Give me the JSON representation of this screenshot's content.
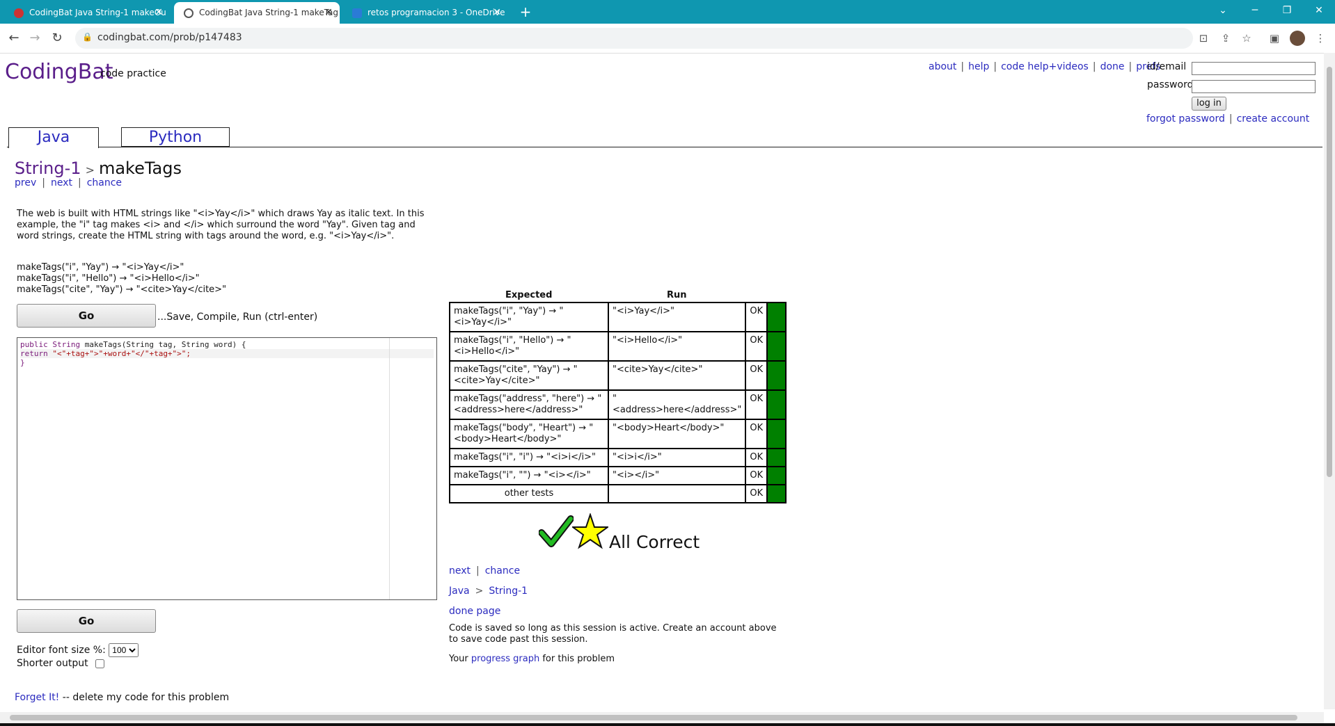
{
  "browser": {
    "tabs": [
      {
        "title": "CodingBat Java String-1 makeOu",
        "active": false
      },
      {
        "title": "CodingBat Java String-1 makeTag",
        "active": true
      },
      {
        "title": "retos programacion 3 - OneDrive",
        "active": false
      }
    ],
    "url": "codingbat.com/prob/p147483"
  },
  "site": {
    "logo": "CodingBat",
    "logo_sub": "code practice",
    "toplinks": [
      "about",
      "help",
      "code help+videos",
      "done",
      "prefs"
    ],
    "login": {
      "id_label": "id/email",
      "password_label": "password",
      "login_button": "log in",
      "forgot": "forgot password",
      "create": "create account"
    },
    "lang_tabs": [
      "Java",
      "Python"
    ]
  },
  "problem": {
    "section": "String-1",
    "name": "makeTags",
    "nav": [
      "prev",
      "next",
      "chance"
    ],
    "description": "The web is built with HTML strings like \"<i>Yay</i>\" which draws Yay as italic text. In this example, the \"i\" tag makes <i> and </i> which surround the word \"Yay\". Given tag and word strings, create the HTML string with tags around the word, e.g. \"<i>Yay</i>\".",
    "examples": [
      "makeTags(\"i\", \"Yay\") → \"<i>Yay</i>\"",
      "makeTags(\"i\", \"Hello\") → \"<i>Hello</i>\"",
      "makeTags(\"cite\", \"Yay\") → \"<cite>Yay</cite>\""
    ],
    "go_label": "Go",
    "go_note": "...Save, Compile, Run (ctrl-enter)",
    "code": {
      "line1_kw": "public String",
      "line1_rest": " makeTags(String tag, String word) {",
      "line2_kw": "return",
      "line2_str": " \"<\"+tag+\">\"+word+\"</\"+tag+\">\";",
      "line3": "}"
    },
    "font_size_label": "Editor font size %:",
    "font_size_value": "100",
    "shorter_output_label": "Shorter output",
    "forget_link": "Forget It!",
    "forget_rest": " -- delete my code for this problem"
  },
  "results": {
    "headers": {
      "expected": "Expected",
      "run": "Run"
    },
    "rows": [
      {
        "expected": "makeTags(\"i\", \"Yay\") → \"<i>Yay</i>\"",
        "run": "\"<i>Yay</i>\"",
        "status": "OK"
      },
      {
        "expected": "makeTags(\"i\", \"Hello\") → \"<i>Hello</i>\"",
        "run": "\"<i>Hello</i>\"",
        "status": "OK"
      },
      {
        "expected": "makeTags(\"cite\", \"Yay\") → \"<cite>Yay</cite>\"",
        "run": "\"<cite>Yay</cite>\"",
        "status": "OK"
      },
      {
        "expected": "makeTags(\"address\", \"here\") → \"<address>here</address>\"",
        "run": "\"<address>here</address>\"",
        "status": "OK"
      },
      {
        "expected": "makeTags(\"body\", \"Heart\") → \"<body>Heart</body>\"",
        "run": "\"<body>Heart</body>\"",
        "status": "OK"
      },
      {
        "expected": "makeTags(\"i\", \"i\") → \"<i>i</i>\"",
        "run": "\"<i>i</i>\"",
        "status": "OK"
      },
      {
        "expected": "makeTags(\"i\", \"\") → \"<i></i>\"",
        "run": "\"<i></i>\"",
        "status": "OK"
      },
      {
        "expected": "other tests",
        "run": "",
        "status": "OK"
      }
    ],
    "summary": "All Correct",
    "next": "next",
    "chance": "chance",
    "crumb_lang": "Java",
    "crumb_section": "String-1",
    "done_page": "done page",
    "saved_note": "Code is saved so long as this session is active. Create an account above to save code past this session.",
    "progress_pre": "Your ",
    "progress_link": "progress graph",
    "progress_post": " for this problem"
  },
  "colors": {
    "chrome": "#0f97b0",
    "pass": "#008000",
    "link": "#2b2bbf",
    "logo": "#5a1e8a"
  }
}
